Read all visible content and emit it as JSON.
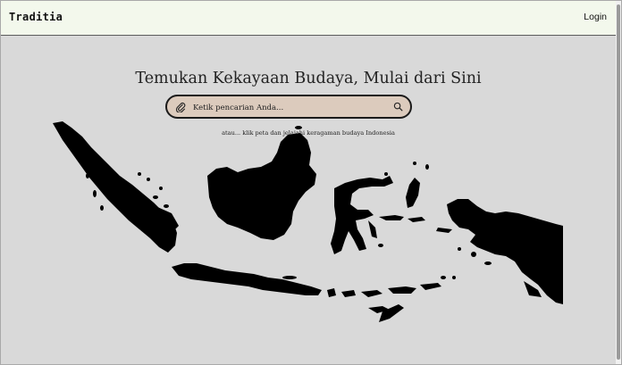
{
  "navbar": {
    "brand": "Traditia",
    "login_label": "Login"
  },
  "hero": {
    "title": "Temukan Kekayaan Budaya, Mulai dari Sini",
    "hint": "atau... klik peta dan jelajahi keragaman budaya Indonesia"
  },
  "search": {
    "placeholder": "Ketik pencarian Anda...",
    "value": "",
    "attach_icon": "paperclip-icon",
    "submit_icon": "search-icon"
  },
  "map": {
    "regions": [
      "Sumatra",
      "Kalimantan",
      "Sulawesi",
      "Jawa",
      "Nusa Tenggara",
      "Maluku",
      "Papua"
    ]
  },
  "colors": {
    "navbar_bg": "#f3f8ec",
    "page_bg": "#d9d9d9",
    "search_bg": "#dccbbd",
    "map_fill": "#000000"
  }
}
